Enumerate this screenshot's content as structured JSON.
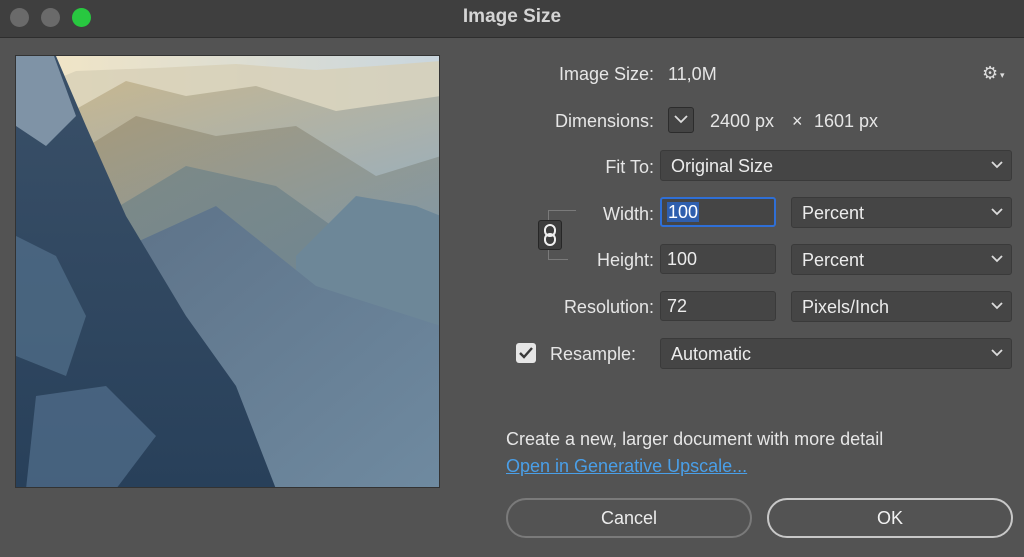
{
  "window": {
    "title": "Image Size"
  },
  "info": {
    "image_size_label": "Image Size:",
    "image_size_value": "11,0M",
    "dimensions_label": "Dimensions:",
    "dimensions_width": "2400 px",
    "dimensions_times": "×",
    "dimensions_height": "1601 px"
  },
  "fit_to": {
    "label": "Fit To:",
    "value": "Original Size"
  },
  "width": {
    "label": "Width:",
    "value": "100",
    "unit": "Percent"
  },
  "height": {
    "label": "Height:",
    "value": "100",
    "unit": "Percent"
  },
  "resolution": {
    "label": "Resolution:",
    "value": "72",
    "unit": "Pixels/Inch"
  },
  "resample": {
    "label": "Resample:",
    "checked": true,
    "value": "Automatic"
  },
  "upscale": {
    "description": "Create a new, larger document with more detail",
    "link": "Open in Generative Upscale..."
  },
  "buttons": {
    "cancel": "Cancel",
    "ok": "OK"
  },
  "icons": {
    "gear": "gear-icon",
    "chain": "chain-link-icon",
    "chevron": "chevron-down-icon",
    "check": "checkmark-icon"
  },
  "colors": {
    "accent": "#2f6fd6",
    "link": "#4a9fe8",
    "zoom_button": "#28c840"
  }
}
